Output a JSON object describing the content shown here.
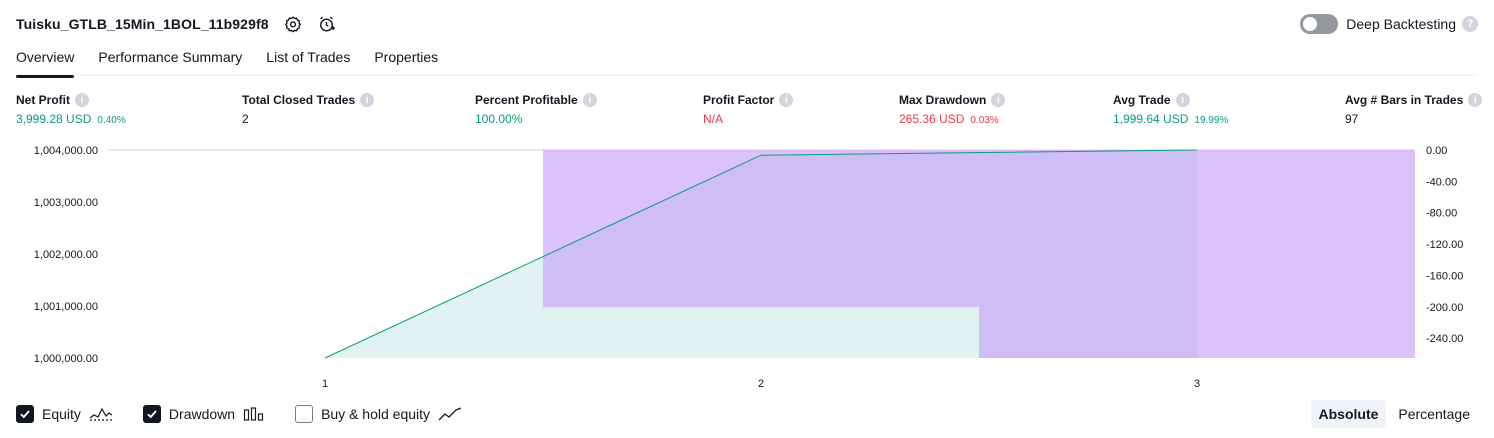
{
  "header": {
    "title": "Tuisku_GTLB_15Min_1BOL_11b929f8",
    "icons": [
      "settings-icon",
      "add-alert-icon"
    ]
  },
  "deep_backtesting": {
    "label": "Deep Backtesting",
    "enabled": false,
    "help": "?"
  },
  "tabs": [
    {
      "label": "Overview",
      "active": true
    },
    {
      "label": "Performance Summary",
      "active": false
    },
    {
      "label": "List of Trades",
      "active": false
    },
    {
      "label": "Properties",
      "active": false
    }
  ],
  "metrics": {
    "net_profit": {
      "label": "Net Profit",
      "value": "3,999.28 USD",
      "pct": "0.40%",
      "color": "#089981"
    },
    "total_closed_trades": {
      "label": "Total Closed Trades",
      "value": "2"
    },
    "percent_profitable": {
      "label": "Percent Profitable",
      "value": "100.00%",
      "color": "#089981"
    },
    "profit_factor": {
      "label": "Profit Factor",
      "value": "N/A",
      "color": "#f23645"
    },
    "max_drawdown": {
      "label": "Max Drawdown",
      "value": "265.36 USD",
      "pct": "0.03%",
      "color": "#f23645"
    },
    "avg_trade": {
      "label": "Avg Trade",
      "value": "1,999.64 USD",
      "pct": "19.99%",
      "color": "#089981"
    },
    "avg_bars": {
      "label": "Avg # Bars in Trades",
      "value": "97"
    },
    "info_glyph": "i"
  },
  "chart_data": {
    "type": "area",
    "x": [
      1,
      2,
      3
    ],
    "x_tick_labels": [
      "1",
      "2",
      "3"
    ],
    "y_left_ticks": [
      "1,004,000.00",
      "1,003,000.00",
      "1,002,000.00",
      "1,001,000.00",
      "1,000,000.00"
    ],
    "y_left_range": [
      1000000,
      1004000
    ],
    "y_right_ticks": [
      "0.00",
      "-40.00",
      "-80.00",
      "-120.00",
      "-160.00",
      "-200.00",
      "-240.00"
    ],
    "y_right_range": [
      -265.36,
      0
    ],
    "equity": {
      "x": [
        1,
        2,
        3
      ],
      "values": [
        1000000,
        1003900,
        1003999.28
      ],
      "color": "#089981"
    },
    "drawdown": {
      "color": "#c39bf6",
      "bars": [
        {
          "x_start": 0.5,
          "x_end": 1.5,
          "value": 0
        },
        {
          "x_start": 1.5,
          "x_end": 2.5,
          "value": -200.5
        },
        {
          "x_start": 2.5,
          "x_end": 3.5,
          "value": -265.36
        }
      ]
    }
  },
  "footer": {
    "legend": [
      {
        "label": "Equity",
        "checked": true,
        "icon": "equity-line-icon"
      },
      {
        "label": "Drawdown",
        "checked": true,
        "icon": "drawdown-bars-icon"
      },
      {
        "label": "Buy & hold equity",
        "checked": false,
        "icon": "buy-hold-line-icon"
      }
    ],
    "modes": [
      {
        "label": "Absolute",
        "active": true
      },
      {
        "label": "Percentage",
        "active": false
      }
    ]
  }
}
